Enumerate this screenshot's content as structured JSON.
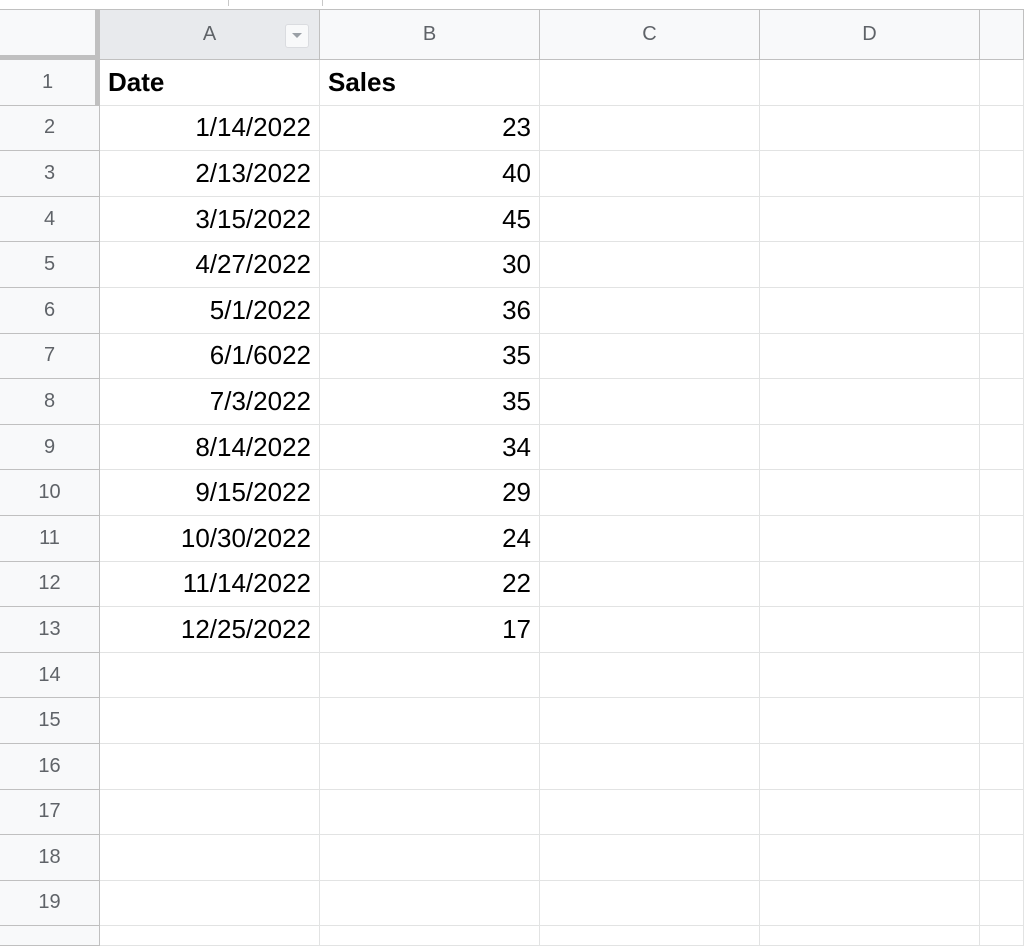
{
  "sheet": {
    "column_headers": [
      "A",
      "B",
      "C",
      "D"
    ],
    "row_headers": [
      "1",
      "2",
      "3",
      "4",
      "5",
      "6",
      "7",
      "8",
      "9",
      "10",
      "11",
      "12",
      "13",
      "14",
      "15",
      "16",
      "17",
      "18",
      "19"
    ],
    "filter_icon": "dropdown-arrow-icon",
    "rows": [
      {
        "a": "Date",
        "b": "Sales"
      },
      {
        "a": "1/14/2022",
        "b": "23"
      },
      {
        "a": "2/13/2022",
        "b": "40"
      },
      {
        "a": "3/15/2022",
        "b": "45"
      },
      {
        "a": "4/27/2022",
        "b": "30"
      },
      {
        "a": "5/1/2022",
        "b": "36"
      },
      {
        "a": "6/1/6022",
        "b": "35"
      },
      {
        "a": "7/3/2022",
        "b": "35"
      },
      {
        "a": "8/14/2022",
        "b": "34"
      },
      {
        "a": "9/15/2022",
        "b": "29"
      },
      {
        "a": "10/30/2022",
        "b": "24"
      },
      {
        "a": "11/14/2022",
        "b": "22"
      },
      {
        "a": "12/25/2022",
        "b": "17"
      }
    ]
  },
  "colors": {
    "header_bg": "#f8f9fa",
    "header_text": "#5f6368",
    "gridline": "#e2e3e3",
    "header_border": "#c0c0c0"
  }
}
